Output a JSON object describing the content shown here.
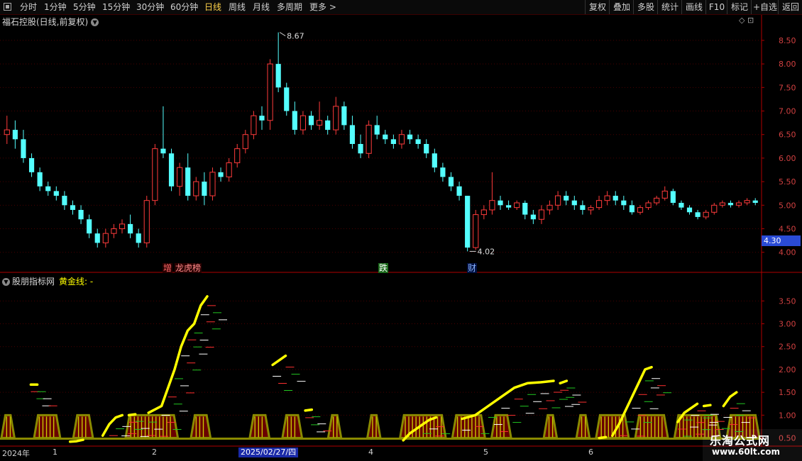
{
  "toolbar": {
    "periods": [
      {
        "label": "分时"
      },
      {
        "label": "1分钟"
      },
      {
        "label": "5分钟"
      },
      {
        "label": "15分钟"
      },
      {
        "label": "30分钟"
      },
      {
        "label": "60分钟"
      },
      {
        "label": "日线",
        "active": true
      },
      {
        "label": "周线"
      },
      {
        "label": "月线"
      },
      {
        "label": "多周期"
      },
      {
        "label": "更多 >"
      }
    ],
    "right_buttons": [
      "复权",
      "叠加",
      "多股",
      "统计",
      "画线",
      "F10",
      "标记",
      "+自选",
      "返回"
    ]
  },
  "stock": {
    "title": "福石控股(日线,前复权)",
    "current_price": "4.30",
    "high_label": "8.67",
    "low_label": "4.02",
    "small_icons": "◇ ⊡"
  },
  "indicator": {
    "name": "股朋指标网",
    "line_label": "黄金线: -"
  },
  "tags": [
    {
      "text": "增",
      "color": "#ff6a6a",
      "bg": "#2a0000"
    },
    {
      "text": "龙虎榜",
      "color": "#ff8c8c",
      "bg": "#2a0000"
    },
    {
      "text": "跌",
      "color": "#ffffff",
      "bg": "#1c6b1c"
    },
    {
      "text": "财",
      "color": "#8ab4ff",
      "bg": "#001040"
    }
  ],
  "xaxis": {
    "labels": [
      "2024年",
      "1",
      "2",
      "4",
      "5",
      "6"
    ],
    "selected_date": "2025/02/27/四"
  },
  "watermark": {
    "line1": "乐淘公式网",
    "line2": "www.60lt.com"
  },
  "colors": {
    "up": "#ff3b3b",
    "down": "#54ffff",
    "grid": "#4a0000",
    "axis": "#b00000",
    "gold": "#ffff00",
    "olive": "#8a8a00"
  },
  "chart_data": [
    {
      "type": "candlestick",
      "title": "福石控股(日线,前复权)",
      "ylim": [
        3.8,
        8.8
      ],
      "y_ticks": [
        4.0,
        4.5,
        5.0,
        5.5,
        6.0,
        6.5,
        7.0,
        7.5,
        8.0,
        8.5
      ],
      "ohlc": [
        [
          6.5,
          6.9,
          6.3,
          6.6
        ],
        [
          6.6,
          6.8,
          6.2,
          6.4
        ],
        [
          6.4,
          6.6,
          5.9,
          6.0
        ],
        [
          6.0,
          6.1,
          5.6,
          5.7
        ],
        [
          5.7,
          5.8,
          5.3,
          5.4
        ],
        [
          5.4,
          5.5,
          5.2,
          5.3
        ],
        [
          5.3,
          5.4,
          5.1,
          5.2
        ],
        [
          5.2,
          5.3,
          4.9,
          5.0
        ],
        [
          5.0,
          5.1,
          4.8,
          4.9
        ],
        [
          4.9,
          5.0,
          4.6,
          4.7
        ],
        [
          4.7,
          4.8,
          4.3,
          4.4
        ],
        [
          4.4,
          4.5,
          4.1,
          4.2
        ],
        [
          4.2,
          4.5,
          4.1,
          4.4
        ],
        [
          4.4,
          4.6,
          4.3,
          4.5
        ],
        [
          4.5,
          4.7,
          4.4,
          4.6
        ],
        [
          4.6,
          4.8,
          4.3,
          4.4
        ],
        [
          4.4,
          4.5,
          4.1,
          4.2
        ],
        [
          4.2,
          5.2,
          4.1,
          5.1
        ],
        [
          5.1,
          6.3,
          5.0,
          6.2
        ],
        [
          6.2,
          7.1,
          6.0,
          6.1
        ],
        [
          6.1,
          6.2,
          5.3,
          5.4
        ],
        [
          5.4,
          5.9,
          5.2,
          5.8
        ],
        [
          5.8,
          6.1,
          5.1,
          5.2
        ],
        [
          5.2,
          5.6,
          5.1,
          5.5
        ],
        [
          5.5,
          5.7,
          5.0,
          5.2
        ],
        [
          5.2,
          5.8,
          5.1,
          5.7
        ],
        [
          5.7,
          5.8,
          5.5,
          5.6
        ],
        [
          5.6,
          6.0,
          5.5,
          5.9
        ],
        [
          5.9,
          6.3,
          5.8,
          6.2
        ],
        [
          6.2,
          6.6,
          6.1,
          6.5
        ],
        [
          6.5,
          7.0,
          6.4,
          6.9
        ],
        [
          6.9,
          7.1,
          6.6,
          6.8
        ],
        [
          6.8,
          8.1,
          6.6,
          8.0
        ],
        [
          8.0,
          8.67,
          7.4,
          7.5
        ],
        [
          7.5,
          7.6,
          6.9,
          7.0
        ],
        [
          7.0,
          7.2,
          6.5,
          6.6
        ],
        [
          6.6,
          7.0,
          6.5,
          6.9
        ],
        [
          6.9,
          7.0,
          6.6,
          6.7
        ],
        [
          6.7,
          7.2,
          6.6,
          6.8
        ],
        [
          6.8,
          6.9,
          6.5,
          6.6
        ],
        [
          6.6,
          7.3,
          6.5,
          7.1
        ],
        [
          7.1,
          7.2,
          6.6,
          6.7
        ],
        [
          6.7,
          6.9,
          6.2,
          6.3
        ],
        [
          6.3,
          6.5,
          6.0,
          6.1
        ],
        [
          6.1,
          6.8,
          6.0,
          6.7
        ],
        [
          6.7,
          6.9,
          6.4,
          6.5
        ],
        [
          6.5,
          6.6,
          6.3,
          6.4
        ],
        [
          6.4,
          6.5,
          6.2,
          6.3
        ],
        [
          6.3,
          6.6,
          6.2,
          6.5
        ],
        [
          6.5,
          6.6,
          6.3,
          6.4
        ],
        [
          6.4,
          6.5,
          6.2,
          6.3
        ],
        [
          6.3,
          6.4,
          6.0,
          6.1
        ],
        [
          6.1,
          6.2,
          5.7,
          5.8
        ],
        [
          5.8,
          5.9,
          5.5,
          5.6
        ],
        [
          5.6,
          5.7,
          5.3,
          5.4
        ],
        [
          5.4,
          5.5,
          5.1,
          5.2
        ],
        [
          5.2,
          5.2,
          4.02,
          4.1
        ],
        [
          4.1,
          4.9,
          4.05,
          4.8
        ],
        [
          4.8,
          5.0,
          4.7,
          4.9
        ],
        [
          4.9,
          5.7,
          4.8,
          5.1
        ],
        [
          5.1,
          5.2,
          4.9,
          5.0
        ],
        [
          5.0,
          5.1,
          4.9,
          4.95
        ],
        [
          4.95,
          5.1,
          4.9,
          5.05
        ],
        [
          5.05,
          5.1,
          4.7,
          4.8
        ],
        [
          4.8,
          4.9,
          4.6,
          4.7
        ],
        [
          4.7,
          5.0,
          4.6,
          4.9
        ],
        [
          4.9,
          5.1,
          4.8,
          5.0
        ],
        [
          5.0,
          5.3,
          4.9,
          5.2
        ],
        [
          5.2,
          5.3,
          5.0,
          5.1
        ],
        [
          5.1,
          5.2,
          4.9,
          5.0
        ],
        [
          5.0,
          5.1,
          4.8,
          4.9
        ],
        [
          4.9,
          5.0,
          4.8,
          4.95
        ],
        [
          4.95,
          5.2,
          4.9,
          5.1
        ],
        [
          5.1,
          5.3,
          5.0,
          5.2
        ],
        [
          5.2,
          5.3,
          5.0,
          5.1
        ],
        [
          5.1,
          5.2,
          4.9,
          5.0
        ],
        [
          5.0,
          5.1,
          4.8,
          4.85
        ],
        [
          4.85,
          5.0,
          4.8,
          4.95
        ],
        [
          4.95,
          5.1,
          4.9,
          5.05
        ],
        [
          5.05,
          5.2,
          5.0,
          5.15
        ],
        [
          5.15,
          5.4,
          5.1,
          5.3
        ],
        [
          5.3,
          5.35,
          5.0,
          5.05
        ],
        [
          5.05,
          5.1,
          4.9,
          4.95
        ],
        [
          4.95,
          5.0,
          4.8,
          4.85
        ],
        [
          4.85,
          4.9,
          4.7,
          4.75
        ],
        [
          4.75,
          4.9,
          4.7,
          4.85
        ],
        [
          4.85,
          5.05,
          4.8,
          5.0
        ],
        [
          5.0,
          5.1,
          4.95,
          5.05
        ],
        [
          5.05,
          5.1,
          4.95,
          5.0
        ],
        [
          5.0,
          5.1,
          4.95,
          5.05
        ],
        [
          5.05,
          5.15,
          5.0,
          5.1
        ],
        [
          5.1,
          5.15,
          5.0,
          5.05
        ]
      ]
    },
    {
      "type": "line",
      "title": "股朋指标网",
      "ylim": [
        0.4,
        3.8
      ],
      "y_ticks": [
        0.5,
        1.0,
        1.5,
        2.0,
        2.5,
        3.0,
        3.5
      ],
      "series": [
        {
          "name": "黄金线",
          "segments": [
            [
              [
                4.5,
                1.67
              ],
              [
                5.5,
                1.67
              ]
            ],
            [
              [
                10.5,
                0.42
              ],
              [
                11.5,
                0.43
              ],
              [
                12.5,
                0.46
              ]
            ],
            [
              [
                15.5,
                0.55
              ],
              [
                16.5,
                0.8
              ],
              [
                17.5,
                0.95
              ],
              [
                18.5,
                1.0
              ]
            ],
            [
              [
                19.5,
                1.0
              ],
              [
                20.5,
                1.02
              ]
            ],
            [
              [
                22.5,
                1.05
              ],
              [
                24.5,
                1.2
              ],
              [
                25.5,
                1.6
              ],
              [
                26.5,
                2.0
              ],
              [
                27.5,
                2.5
              ],
              [
                28.5,
                2.85
              ],
              [
                29.5,
                3.0
              ],
              [
                30.5,
                3.4
              ],
              [
                31.5,
                3.6
              ]
            ],
            [
              [
                41.5,
                2.1
              ],
              [
                43.5,
                2.3
              ]
            ],
            [
              [
                46.5,
                1.1
              ],
              [
                47.5,
                1.12
              ]
            ],
            [
              [
                61.5,
                0.45
              ],
              [
                62.5,
                0.6
              ],
              [
                63.5,
                0.7
              ],
              [
                64.5,
                0.8
              ],
              [
                65.5,
                0.9
              ],
              [
                66.5,
                0.95
              ]
            ],
            [
              [
                70.5,
                0.92
              ],
              [
                72.5,
                1.0
              ],
              [
                74.5,
                1.2
              ],
              [
                76.5,
                1.4
              ],
              [
                78.5,
                1.6
              ],
              [
                80.5,
                1.7
              ],
              [
                82.5,
                1.72
              ],
              [
                84.5,
                1.75
              ]
            ],
            [
              [
                85.5,
                1.7
              ],
              [
                86.5,
                1.75
              ]
            ],
            [
              [
                91.5,
                0.5
              ],
              [
                92.5,
                0.52
              ]
            ],
            [
              [
                93.5,
                0.55
              ],
              [
                94.5,
                0.8
              ],
              [
                95.5,
                1.1
              ],
              [
                96.5,
                1.4
              ],
              [
                97.5,
                1.7
              ],
              [
                98.5,
                2.0
              ],
              [
                99.5,
                2.05
              ]
            ],
            [
              [
                103.5,
                0.85
              ],
              [
                104.5,
                1.05
              ],
              [
                105.5,
                1.15
              ],
              [
                106.5,
                1.25
              ]
            ],
            [
              [
                107.5,
                1.2
              ],
              [
                108.5,
                1.22
              ]
            ],
            [
              [
                110.5,
                1.2
              ],
              [
                111.5,
                1.4
              ],
              [
                112.5,
                1.5
              ]
            ]
          ]
        }
      ],
      "bands": [
        [
          0,
          1
        ],
        [
          5,
          8
        ],
        [
          11,
          13
        ],
        [
          19,
          26
        ],
        [
          29,
          31
        ],
        [
          38,
          40
        ],
        [
          43,
          45
        ],
        [
          50,
          51
        ],
        [
          56,
          57
        ],
        [
          61,
          67
        ],
        [
          69,
          73
        ],
        [
          75,
          77
        ],
        [
          83,
          84
        ],
        [
          88,
          89
        ],
        [
          91,
          95
        ],
        [
          97,
          101
        ],
        [
          103,
          109
        ],
        [
          111,
          115
        ]
      ]
    }
  ]
}
